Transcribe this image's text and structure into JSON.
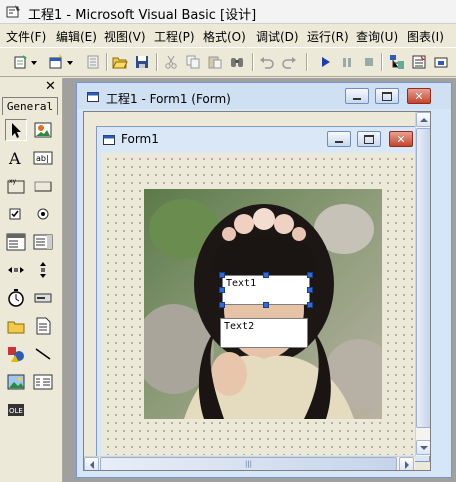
{
  "app": {
    "title": "工程1 - Microsoft Visual Basic [设计]"
  },
  "menu": [
    "文件(F)",
    "编辑(E)",
    "视图(V)",
    "工程(P)",
    "格式(O)",
    "调试(D)",
    "运行(R)",
    "查询(U)",
    "图表(I)"
  ],
  "toolbox": {
    "tab_label": "General",
    "close_label": "✕",
    "tools": [
      "pointer",
      "picturebox",
      "label",
      "textbox",
      "frame",
      "commandbutton",
      "checkbox",
      "optionbutton",
      "combobox",
      "listbox",
      "hscrollbar",
      "vscrollbar",
      "timer",
      "drivelistbox",
      "dirlistbox",
      "filelistbox",
      "shape",
      "line",
      "image",
      "data",
      "ole"
    ]
  },
  "project_window": {
    "title": "工程1 - Form1 (Form)"
  },
  "form": {
    "caption": "Form1",
    "textboxes": [
      {
        "name": "text1",
        "text": "Text1"
      },
      {
        "name": "text2",
        "text": "Text2"
      }
    ]
  },
  "scrollbar": {
    "grip": "|||"
  }
}
